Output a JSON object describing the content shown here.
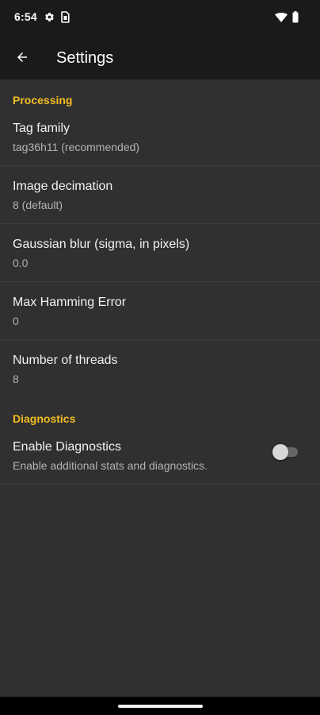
{
  "status_bar": {
    "time": "6:54",
    "icons": [
      "gear-icon",
      "sim-card-icon",
      "wifi-icon",
      "battery-icon"
    ]
  },
  "app_bar": {
    "title": "Settings",
    "back_icon": "arrow-left-icon"
  },
  "sections": {
    "processing": {
      "header": "Processing",
      "items": [
        {
          "title": "Tag family",
          "summary": "tag36h11 (recommended)"
        },
        {
          "title": "Image decimation",
          "summary": "8 (default)"
        },
        {
          "title": "Gaussian blur (sigma, in pixels)",
          "summary": "0.0"
        },
        {
          "title": "Max Hamming Error",
          "summary": "0"
        },
        {
          "title": "Number of threads",
          "summary": "8"
        }
      ]
    },
    "diagnostics": {
      "header": "Diagnostics",
      "item": {
        "title": "Enable Diagnostics",
        "summary": "Enable additional stats and diagnostics.",
        "enabled": false
      }
    }
  },
  "colors": {
    "accent": "#f3bd21",
    "background": "#303030",
    "app_bar": "#1c1a19"
  }
}
